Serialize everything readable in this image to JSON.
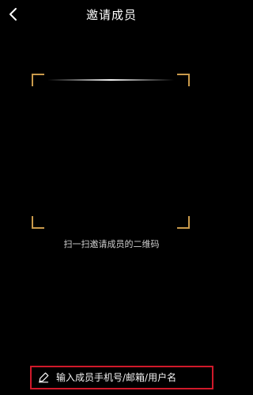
{
  "header": {
    "title": "邀请成员",
    "back_icon": "chevron-left-icon"
  },
  "scanner": {
    "hint": "扫一扫邀请成员的二维码",
    "corner_color": "#c99a4b"
  },
  "manual_entry": {
    "label": "输入成员手机号/邮箱/用户名",
    "icon": "edit-icon",
    "highlight_color": "#d0192a"
  }
}
